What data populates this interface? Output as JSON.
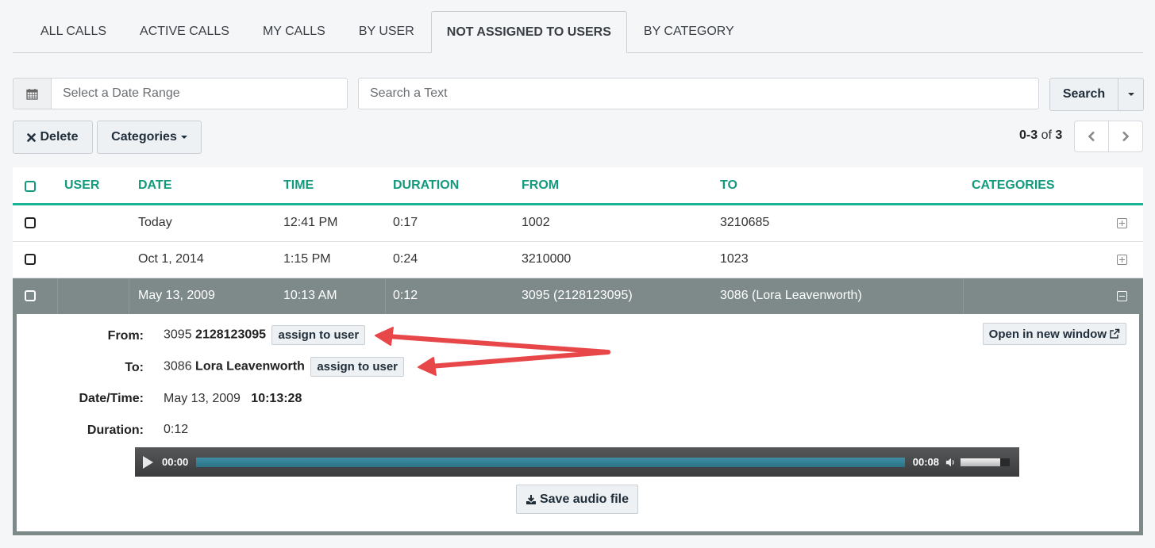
{
  "tabs": [
    {
      "label": "ALL CALLS",
      "active": false
    },
    {
      "label": "ACTIVE CALLS",
      "active": false
    },
    {
      "label": "MY CALLS",
      "active": false
    },
    {
      "label": "BY USER",
      "active": false
    },
    {
      "label": "NOT ASSIGNED TO USERS",
      "active": true
    },
    {
      "label": "BY CATEGORY",
      "active": false
    }
  ],
  "filters": {
    "date_range_placeholder": "Select a Date Range",
    "date_range_value": "",
    "search_placeholder": "Search a Text",
    "search_value": "",
    "search_label": "Search",
    "calendar_icon": "calendar-icon"
  },
  "actions": {
    "delete_label": "Delete",
    "categories_label": "Categories"
  },
  "pagination": {
    "range": "0-3",
    "of_label": "of",
    "total": "3"
  },
  "table": {
    "columns": [
      "USER",
      "DATE",
      "TIME",
      "DURATION",
      "FROM",
      "TO",
      "CATEGORIES"
    ],
    "rows": [
      {
        "user": "",
        "date": "Today",
        "time": "12:41 PM",
        "duration": "0:17",
        "from": "1002",
        "to": "3210685",
        "categories": "",
        "expanded": false
      },
      {
        "user": "",
        "date": "Oct 1, 2014",
        "time": "1:15 PM",
        "duration": "0:24",
        "from": "3210000",
        "to": "1023",
        "categories": "",
        "expanded": false
      },
      {
        "user": "",
        "date": "May 13, 2009",
        "time": "10:13 AM",
        "duration": "0:12",
        "from": "3095 (2128123095)",
        "to": "3086 (Lora Leavenworth)",
        "categories": "",
        "expanded": true
      }
    ]
  },
  "detail": {
    "from_label": "From:",
    "from_ext": "3095",
    "from_number": "2128123095",
    "to_label": "To:",
    "to_ext": "3086",
    "to_name": "Lora Leavenworth",
    "assign_label": "assign to user",
    "datetime_label": "Date/Time:",
    "date": "May 13, 2009",
    "time": "10:13:28",
    "duration_label": "Duration:",
    "duration": "0:12",
    "open_window_label": "Open in new window",
    "save_audio_label": "Save audio file"
  },
  "player": {
    "current_time": "00:00",
    "total_time": "00:08",
    "progress": 0,
    "volume": 0.8
  },
  "colors": {
    "accent": "#1ab394",
    "header_text": "#139a7d",
    "selected_row": "#7e8a8a",
    "annotation_arrow": "#e8474a"
  }
}
